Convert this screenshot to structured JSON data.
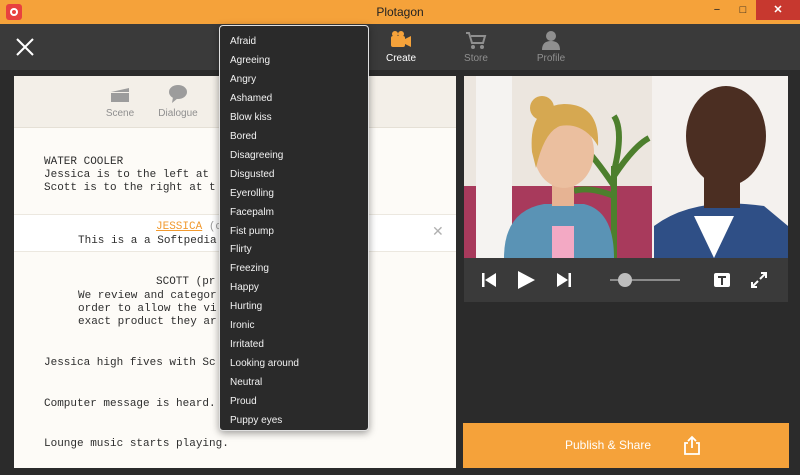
{
  "window": {
    "title": "Plotagon",
    "minimize": "−",
    "maximize": "□",
    "close": "✕"
  },
  "nav": [
    {
      "label": "Create",
      "icon": "camera-icon",
      "active": true
    },
    {
      "label": "Store",
      "icon": "cart-icon",
      "active": false
    },
    {
      "label": "Profile",
      "icon": "profile-icon",
      "active": false
    }
  ],
  "panel_tabs": [
    {
      "label": "Scene",
      "icon": "scene-icon"
    },
    {
      "label": "Dialogue",
      "icon": "dialogue-icon"
    }
  ],
  "script": {
    "scene_heading": "WATER COOLER",
    "scene_line_1": "Jessica is to the left at",
    "scene_line_2": "Scott is to the right at t",
    "dialogue_character": "JESSICA",
    "dialogue_rest": " (c",
    "dialogue_line": "This is a a Softpedia",
    "scott_heading": "SCOTT (pr",
    "scott_line_1": "We review and categor",
    "scott_line_2": "order to allow the vi",
    "scott_line_3": "exact product they ar",
    "action_1": "Jessica high fives with Sc",
    "action_2": "Computer message is heard.",
    "action_3": "Lounge music starts playing."
  },
  "publish": {
    "label": "Publish & Share"
  },
  "dropdown_items": [
    "Afraid",
    "Agreeing",
    "Angry",
    "Ashamed",
    "Blow kiss",
    "Bored",
    "Disagreeing",
    "Disgusted",
    "Eyerolling",
    "Facepalm",
    "Fist pump",
    "Flirty",
    "Freezing",
    "Happy",
    "Hurting",
    "Ironic",
    "Irritated",
    "Looking around",
    "Neutral",
    "Proud",
    "Puppy eyes"
  ],
  "colors": {
    "accent": "#f5a23a",
    "toolbar": "#3a3a3a",
    "menu": "#2a2a2a"
  },
  "playback": {
    "progress": 0.22
  }
}
